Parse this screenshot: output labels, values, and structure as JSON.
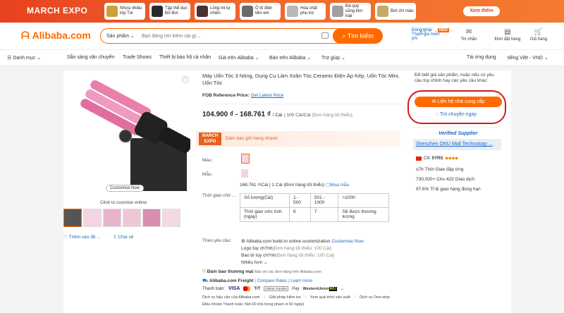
{
  "banner": {
    "logo": "MARCH EXPO",
    "items": [
      {
        "label": "Nhựa nhiều lớp Túi",
        "color": "#c9a23b"
      },
      {
        "label": "Tập thể dục Đồ Bơi",
        "color": "#2a2a2a"
      },
      {
        "label": "Lồng mi tự nhiên",
        "color": "#3a2a2a"
      },
      {
        "label": "Ô tô điện tiền em",
        "color": "#6a6a6a"
      },
      {
        "label": "Hóa chất phụ trợ",
        "color": "#b8b8b8"
      },
      {
        "label": "Đá quý cũng kim loại",
        "color": "#c8c8c8"
      },
      {
        "label": "Bơt chì màu",
        "color": "#c8a86a"
      }
    ],
    "see_more": "Xem thêm"
  },
  "header": {
    "logo": "Alibaba.com",
    "search_category": "Sản phẩm",
    "search_placeholder": "Bạn đang tìm kiếm cái gì...",
    "search_button": "Tìm kiếm",
    "new_tag": "NEW",
    "login_line1": "Đăng nhập",
    "login_line2": "Tham gia miễn phí",
    "messages": "Tin nhắn",
    "orders": "Đơn đặt hàng",
    "cart": "Giỏ hàng"
  },
  "nav": {
    "categories": "Danh mục",
    "items": [
      "Sẵn sàng vận chuyển",
      "Trade Shows",
      "Thiết bị bảo hộ cá nhân",
      "Giá trên Alibaba",
      "Bán trên Alibaba",
      "Trợ giúp"
    ],
    "download": "Tải ứng dụng",
    "language": "tiếng Việt - VND"
  },
  "product": {
    "title": "Máy Uốn Tóc 3 Nòng, Dụng Cụ Làm Xoăn Tóc Ceramic Điện Áp Kép, Uốn Tóc Mini, Uốn Tóc",
    "fob_label": "FOB Reference Price:",
    "fob_link": "Get Latest Price",
    "price": "104.900 ₫ - 168.761 ₫",
    "price_unit": "/ Cái",
    "moq": "100 Cái/Cái",
    "moq_note": "(Đơn hàng tối thiểu)",
    "customise_badge": "Customise Now",
    "customise_caption": "Click to cusmise online",
    "favorite": "Thêm vào đề ...",
    "share": "Chia sẻ",
    "expo_label": "MARCH EXPO",
    "expo_text": "Đảm bảo gửi hàng nhanh",
    "color_label": "Màu:",
    "model_label": "Mẫu:",
    "model_price_line": "168.761 ₫/Cái | 1 Cái (Đơn hàng tối thiểu)",
    "sample_link": "Mua mẫu",
    "leadtime_label": "Thời gian chờ ...",
    "leadtime_table": {
      "row1": [
        "Số lượng(Cái)",
        "1 - 500",
        "501 - 1000",
        ">1000"
      ],
      "row2": [
        "Thời gian ước tính (ngày)",
        "6",
        "7",
        "Sẽ được thương lượng"
      ]
    },
    "custom_label": "Theo yêu cầu:",
    "custom_line1": "Alibaba.com build-in online customization",
    "custom_link": "Customise Now",
    "custom_line2": "Logo tùy ch?nh",
    "custom_line2_note": "(Đơn hàng tối thiểu: 100 Cái)",
    "custom_line3": "Bao bì tùy ch?nh",
    "custom_line3_note": "(Đơn hàng tối thiểu: 100 Cái)",
    "more": "Nhiều hơn",
    "trade_assurance": "Đảm bảo thương mại",
    "trade_assurance_note": "Bảo vệ các đơn hàng trên Alibaba.com",
    "freight": "Alibaba.com Freight",
    "compare_rates": "Compare Rates",
    "learn_more": "Learn more",
    "payment_label": "Thanh toán:",
    "payments": [
      "VISA",
      "Mastercard",
      "T/T",
      "Online Transfer",
      "Pay",
      "WesternUnion",
      "WU"
    ],
    "service_label": "Dịch vụ hậu cần của Alibaba.com",
    "service2": "Giải pháp kiểm tra",
    "service3": "Xem quá trình sản xuất",
    "service4": "Dịch vụ One-stop",
    "terms": "Điều khoản Thanh toán: Net-60 (trả trong phạm vi 60 ngày)"
  },
  "sidebar": {
    "note": "Để biết giá sản phẩm, hoặc nếu có yêu cầu tùy chỉnh hay các yêu cầu khác:",
    "contact_button": "Liên hệ nhà cung cấp",
    "chat_now": "Trò chuyện ngay",
    "verified": "Verified Supplier",
    "supplier_name": "Shenzhen ONU Mall Technology ...",
    "country": "CN",
    "years": "5YRS",
    "response_label": "≤7h Thời Gian đáp ứng",
    "transactions": "730,000+ Cho 423 Giao dịch",
    "ontime": "97.6% Tỉ lệ giao hàng đúng hạn"
  },
  "colors": {
    "accent": "#ff6a00",
    "highlight_ring": "#d4181f",
    "link": "#1a66c7"
  }
}
